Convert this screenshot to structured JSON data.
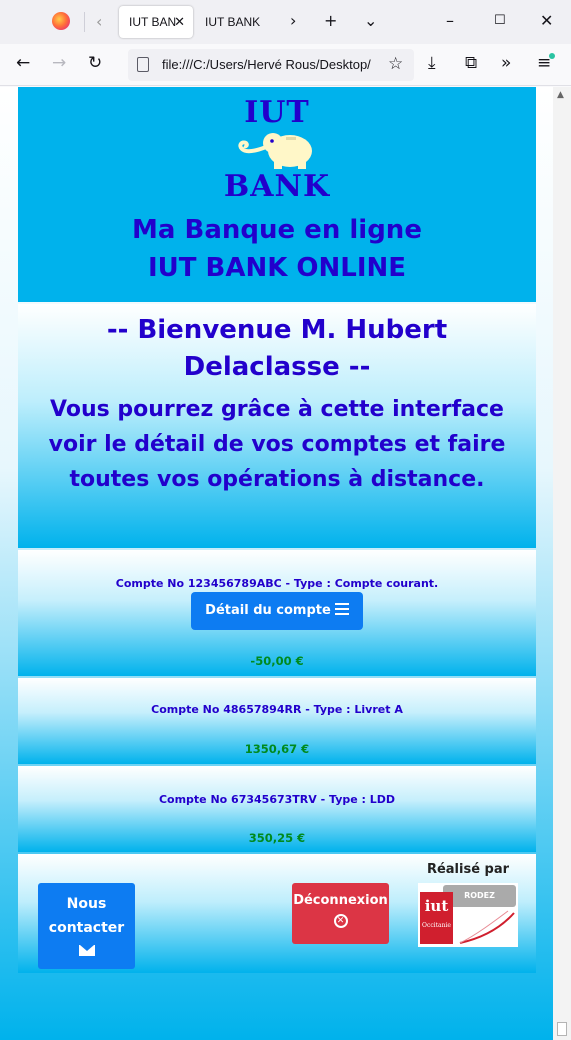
{
  "browser": {
    "tabs": [
      {
        "label": "IUT BAN",
        "active": true
      },
      {
        "label": "IUT BANK",
        "active": false
      }
    ],
    "url": "file:///C:/Users/Hervé Rous/Desktop/",
    "icons": [
      "firefox-icon",
      "back-icon",
      "forward-icon",
      "reload-icon",
      "bookmark-star-icon",
      "downloads-icon",
      "extensions-icon",
      "overflow-icon",
      "menu-icon"
    ]
  },
  "header": {
    "logo_top": "IUT",
    "logo_bottom": "BANK",
    "line1": "Ma Banque en ligne",
    "line2": "IUT BANK ONLINE"
  },
  "welcome": {
    "title": "-- Bienvenue M. Hubert Delaclasse --",
    "text": "Vous pourrez grâce à cette interface voir le détail de vos comptes et faire toutes vos opérations à distance."
  },
  "accounts": [
    {
      "label": "Compte No 123456789ABC - Type : Compte courant.",
      "button": "Détail du compte",
      "balance": "-50,00 €"
    },
    {
      "label": "Compte No 48657894RR - Type : Livret A",
      "balance": "1350,67 €"
    },
    {
      "label": "Compte No 67345673TRV - Type : LDD",
      "balance": "350,25 €"
    }
  ],
  "footer": {
    "contact_label": "Nous contacter",
    "logout_label": "Déconnexion",
    "credit": "Réalisé par",
    "iut_logo_text": "iut",
    "iut_logo_sub": "Occitanie",
    "rodez": "RODEZ"
  },
  "colors": {
    "header_bg": "#00b2ec",
    "title_text": "#2200cc",
    "primary_button": "#0d7cf2",
    "danger_button": "#dc3545",
    "balance_text": "#008a1e"
  }
}
